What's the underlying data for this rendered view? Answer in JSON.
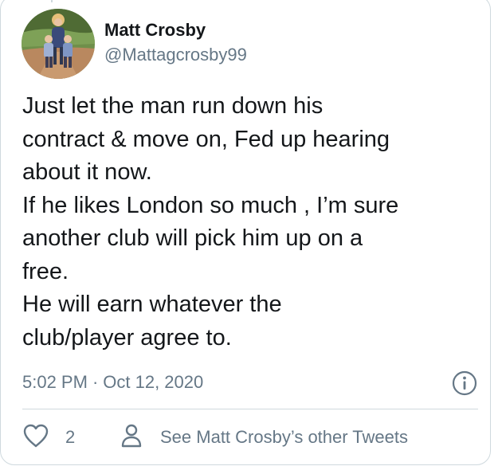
{
  "tweet": {
    "author_name": "Matt Crosby",
    "author_handle": "@Mattagcrosby99",
    "text": "Just let the man run down his\ncontract & move on, Fed up hearing\nabout it now.\nIf he likes London so much , I’m sure\nanother club will pick him up on a\nfree.\nHe will earn whatever the\nclub/player agree to.",
    "time": "5:02 PM",
    "separator": "·",
    "date": "Oct 12, 2020"
  },
  "actions": {
    "like_count": "2",
    "other_tweets_label": "See Matt Crosby’s other Tweets"
  },
  "icons": {
    "like": "heart-icon",
    "profile": "person-icon",
    "info": "info-icon"
  },
  "colors": {
    "text": "#14171a",
    "secondary_text": "#657786",
    "border": "#cfd9de"
  }
}
